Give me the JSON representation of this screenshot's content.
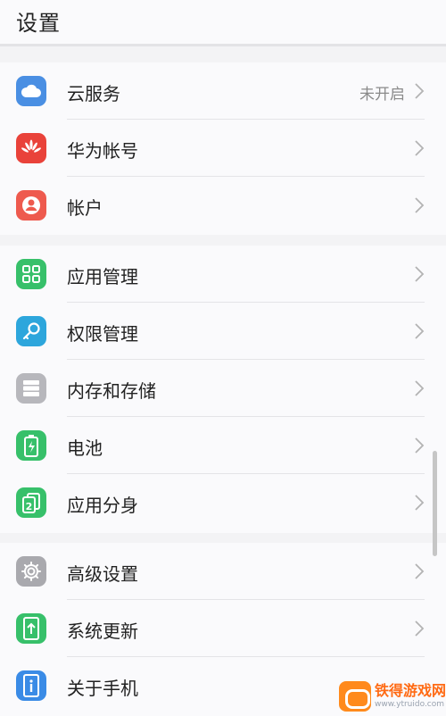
{
  "header": {
    "title": "设置"
  },
  "groups": [
    {
      "items": [
        {
          "label": "云服务",
          "value": "未开启",
          "icon": "cloud-icon",
          "color": "#4a8fe3"
        },
        {
          "label": "华为帐号",
          "icon": "huawei-logo-icon",
          "color": "#e9423a"
        },
        {
          "label": "帐户",
          "icon": "account-icon",
          "color": "#ee5a4e"
        }
      ]
    },
    {
      "items": [
        {
          "label": "应用管理",
          "icon": "apps-grid-icon",
          "color": "#37c06a"
        },
        {
          "label": "权限管理",
          "icon": "key-icon",
          "color": "#2da6dc"
        },
        {
          "label": "内存和存储",
          "icon": "storage-icon",
          "color": "#b7b7bc"
        },
        {
          "label": "电池",
          "icon": "battery-icon",
          "color": "#37c06a"
        },
        {
          "label": "应用分身",
          "icon": "app-twin-icon",
          "color": "#37c06a"
        }
      ]
    },
    {
      "items": [
        {
          "label": "高级设置",
          "icon": "gear-icon",
          "color": "#a9a9ae"
        },
        {
          "label": "系统更新",
          "icon": "system-update-icon",
          "color": "#37c06a"
        },
        {
          "label": "关于手机",
          "icon": "info-icon",
          "color": "#3a8be6"
        }
      ]
    }
  ],
  "watermark": {
    "main": "铁得游戏网",
    "sub": "www.ytruido.com"
  }
}
